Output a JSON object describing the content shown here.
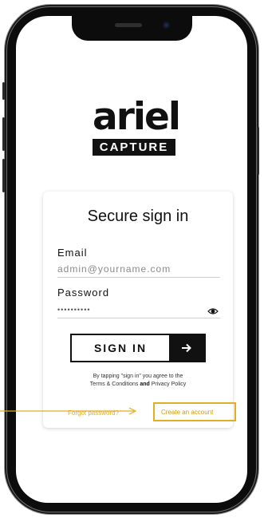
{
  "brand": {
    "name": "ariel",
    "product": "CAPTURE"
  },
  "signin": {
    "title": "Secure sign in",
    "email_label": "Email",
    "email_placeholder": "admin@yourname.com",
    "password_label": "Password",
    "password_value": "••••••••••",
    "button_label": "SIGN IN",
    "terms_prefix": "By tapping \"sign in\" you agree to the",
    "terms_link": "Terms & Conditions",
    "terms_and": "and",
    "privacy_link": "Privacy Policy",
    "forgot_label": "Forgot password?",
    "create_label": "Create an account"
  },
  "colors": {
    "accent": "#e0ae20",
    "ink": "#111111"
  },
  "icons": {
    "password_toggle": "eye-icon",
    "submit": "arrow-right-icon"
  }
}
